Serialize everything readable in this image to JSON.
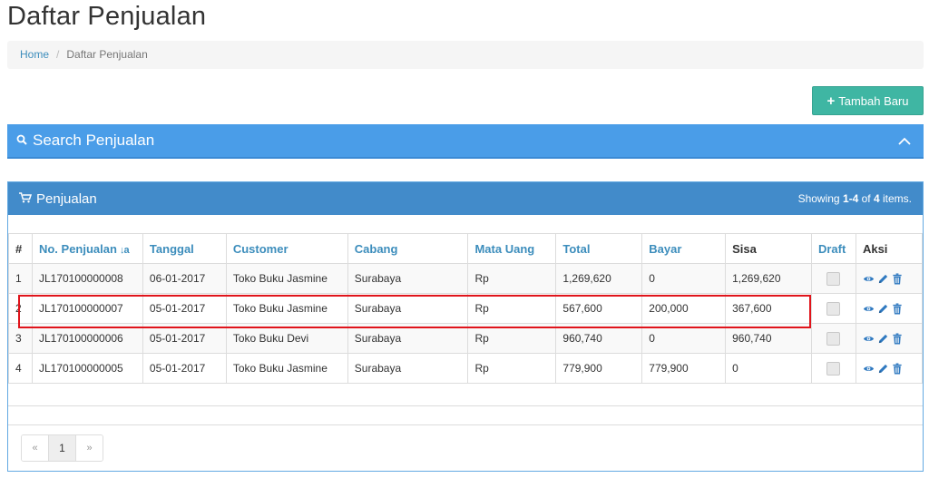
{
  "page": {
    "title": "Daftar Penjualan"
  },
  "breadcrumb": {
    "home": "Home",
    "separator": "/",
    "current": "Daftar Penjualan"
  },
  "add_button": {
    "icon": "plus-icon",
    "label": "Tambah Baru"
  },
  "search_panel": {
    "icon": "search-icon",
    "title": "Search Penjualan",
    "toggle_icon": "chevron-up-icon"
  },
  "panel": {
    "icon": "shopping-cart-icon",
    "title": "Penjualan",
    "summary": {
      "prefix": "Showing ",
      "range": "1-4",
      "mid": " of ",
      "total": "4",
      "suffix": " items."
    }
  },
  "table": {
    "headers": {
      "num": "#",
      "no": "No. Penjualan",
      "tanggal": "Tanggal",
      "customer": "Customer",
      "cabang": "Cabang",
      "mata_uang": "Mata Uang",
      "total": "Total",
      "bayar": "Bayar",
      "sisa": "Sisa",
      "draft": "Draft",
      "aksi": "Aksi"
    },
    "rows": [
      {
        "num": "1",
        "no": "JL170100000008",
        "tanggal": "06-01-2017",
        "customer": "Toko Buku Jasmine",
        "cabang": "Surabaya",
        "mata_uang": "Rp",
        "total": "1,269,620",
        "bayar": "0",
        "sisa": "1,269,620"
      },
      {
        "num": "2",
        "no": "JL170100000007",
        "tanggal": "05-01-2017",
        "customer": "Toko Buku Jasmine",
        "cabang": "Surabaya",
        "mata_uang": "Rp",
        "total": "567,600",
        "bayar": "200,000",
        "sisa": "367,600"
      },
      {
        "num": "3",
        "no": "JL170100000006",
        "tanggal": "05-01-2017",
        "customer": "Toko Buku Devi",
        "cabang": "Surabaya",
        "mata_uang": "Rp",
        "total": "960,740",
        "bayar": "0",
        "sisa": "960,740"
      },
      {
        "num": "4",
        "no": "JL170100000005",
        "tanggal": "05-01-2017",
        "customer": "Toko Buku Jasmine",
        "cabang": "Surabaya",
        "mata_uang": "Rp",
        "total": "779,900",
        "bayar": "779,900",
        "sisa": "0"
      }
    ],
    "row_actions": [
      "view-eye-icon",
      "edit-pencil-icon",
      "delete-trash-icon"
    ]
  },
  "pagination": {
    "prev": "«",
    "current": "1",
    "next": "»"
  },
  "colors": {
    "accent_teal": "#3fb6a3",
    "search_blue": "#4a9de8",
    "panel_blue": "#428bca",
    "link_blue": "#3c8dbc",
    "highlight_red": "#e0141b"
  }
}
